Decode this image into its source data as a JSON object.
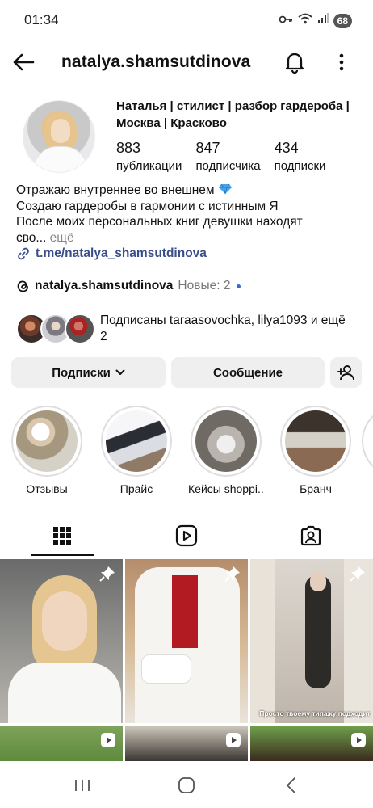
{
  "status_bar": {
    "time": "01:34",
    "battery": "68"
  },
  "header": {
    "username": "natalya.shamsutdinova"
  },
  "profile": {
    "full_name": "Наталья | стилист | разбор гардероба | Москва | Красково",
    "stats": [
      {
        "value": "883",
        "label": "публикации"
      },
      {
        "value": "847",
        "label": "подписчика"
      },
      {
        "value": "434",
        "label": "подписки"
      }
    ],
    "bio_line1": "Отражаю внутреннее во внешнем",
    "bio_line2": "Создаю гардеробы в гармонии с истинным Я",
    "bio_line3": "После моих персональных книг девушки находят",
    "bio_line4": "сво...",
    "bio_more": "ещё",
    "link": "t.me/natalya_shamsutdinova",
    "threads_name": "natalya.shamsutdinova",
    "threads_new": "Новые: 2",
    "followed_by_prefix": "Подписаны",
    "followed_by_names": "taraasovochka, lilya1093",
    "followed_by_suffix": "и ещё 2"
  },
  "buttons": {
    "follow": "Подписки",
    "message": "Сообщение"
  },
  "highlights": [
    {
      "label": "Отзывы"
    },
    {
      "label": "Прайс"
    },
    {
      "label": "Кейсы shoppi..."
    },
    {
      "label": "Бранч"
    }
  ],
  "grid": {
    "caption3": "Просто твоему типажу подходит"
  },
  "colors": {
    "link": "#3a4f8a",
    "accent_dot": "#3a67d6",
    "button_bg": "#efefef"
  },
  "icons": [
    "back-arrow",
    "bell",
    "more-vertical",
    "link",
    "threads",
    "chevron-down",
    "add-person",
    "grid",
    "reels",
    "tagged",
    "pin",
    "reel",
    "nav-recents",
    "nav-home",
    "nav-back"
  ]
}
